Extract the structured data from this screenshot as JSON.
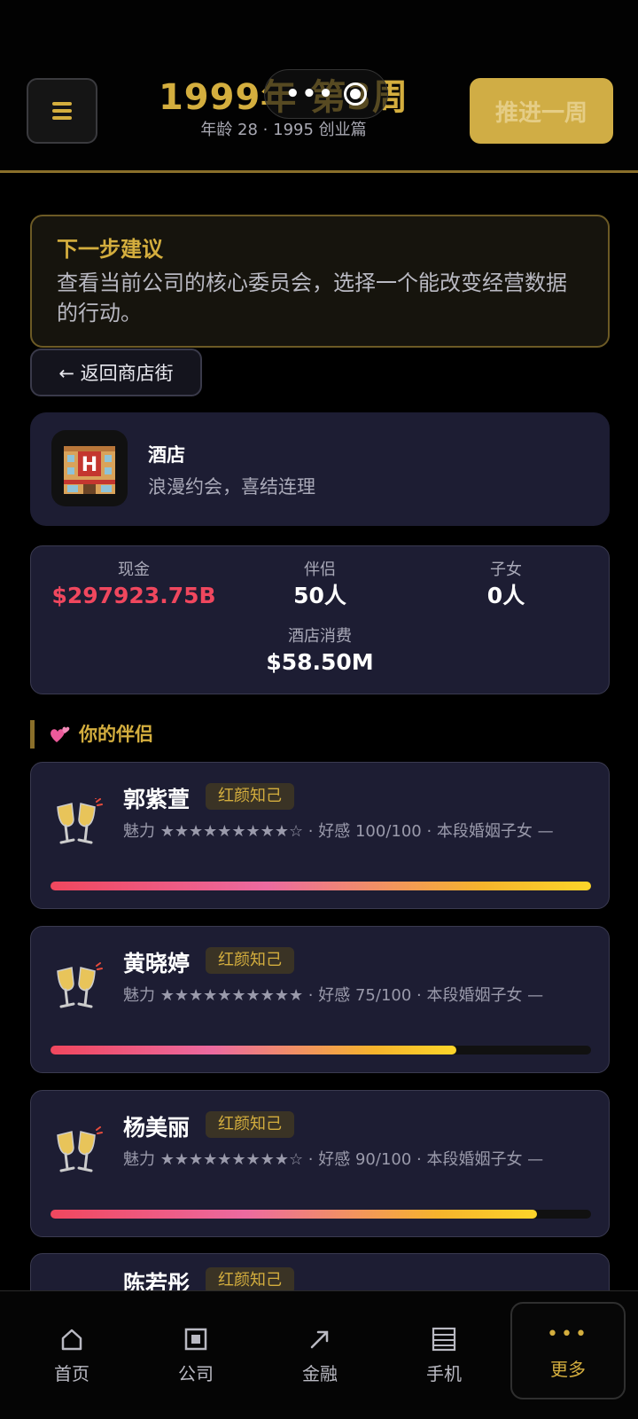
{
  "header": {
    "title": "1999年 第3周",
    "subtitle": "年龄 28 · 1995 创业篇",
    "advance_label": "推进一周"
  },
  "suggestion": {
    "title": "下一步建议",
    "text": "查看当前公司的核心委员会，选择一个能改变经营数据的行动。"
  },
  "back_label": "← 返回商店街",
  "hotel": {
    "title": "酒店",
    "desc": "浪漫约会，喜结连理"
  },
  "stats": {
    "cash_label": "现金",
    "cash_value": "$297923.75B",
    "partners_label": "伴侣",
    "partners_value": "50人",
    "children_label": "子女",
    "children_value": "0人",
    "spend_label": "酒店消费",
    "spend_value": "$58.50M"
  },
  "section_title": "你的伴侣",
  "partners": [
    {
      "name": "郭紫萱",
      "tag": "红颜知己",
      "info": "魅力 ★★★★★★★★★☆ · 好感 100/100 · 本段婚姻子女 —",
      "affection": 1.0
    },
    {
      "name": "黄晓婷",
      "tag": "红颜知己",
      "info": "魅力 ★★★★★★★★★★ · 好感 75/100 · 本段婚姻子女 —",
      "affection": 0.75
    },
    {
      "name": "杨美丽",
      "tag": "红颜知己",
      "info": "魅力 ★★★★★★★★★☆ · 好感 90/100 · 本段婚姻子女 —",
      "affection": 0.9
    },
    {
      "name": "陈若彤",
      "tag": "红颜知己",
      "info": "",
      "affection": 0
    }
  ],
  "nav": {
    "home": "首页",
    "company": "公司",
    "finance": "金融",
    "phone": "手机",
    "more": "更多"
  },
  "colors": {
    "accent": "#d4ae3e",
    "cash_red": "#f0475e",
    "card_bg": "#1d1d33"
  }
}
